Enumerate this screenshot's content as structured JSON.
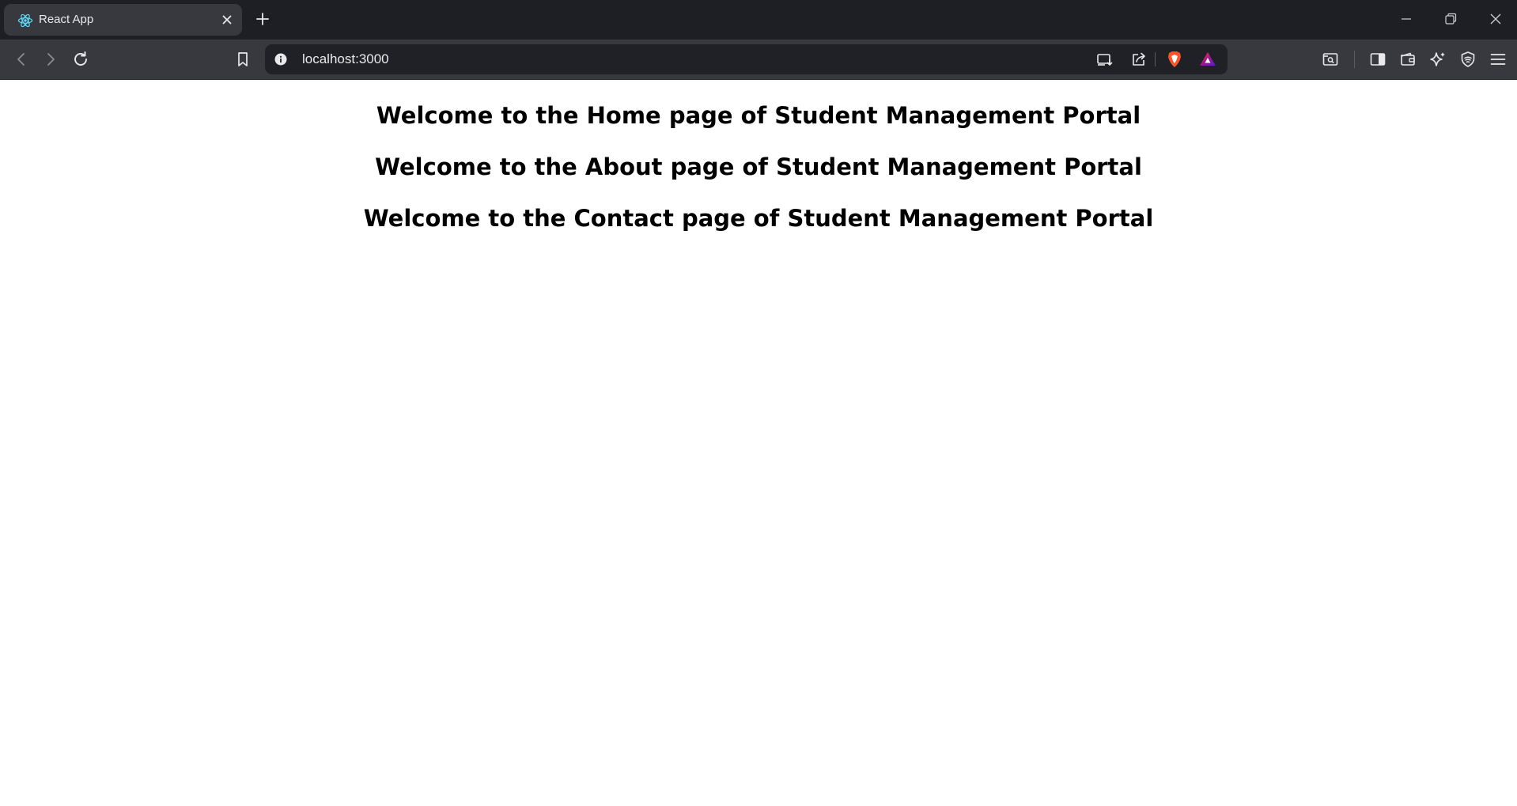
{
  "browser": {
    "tab": {
      "title": "React App",
      "favicon": "react-logo-icon"
    },
    "address_bar": {
      "url": "localhost:3000"
    },
    "colors": {
      "tabstrip_bg": "#1e1f24",
      "toolbar_bg": "#38393e",
      "urlbar_bg": "#202126",
      "react_cyan": "#61dafb",
      "brave_orange": "#fb542b"
    }
  },
  "page": {
    "headings": [
      "Welcome to the Home page of Student Management Portal",
      "Welcome to the About page of Student Management Portal",
      "Welcome to the Contact page of Student Management Portal"
    ]
  }
}
